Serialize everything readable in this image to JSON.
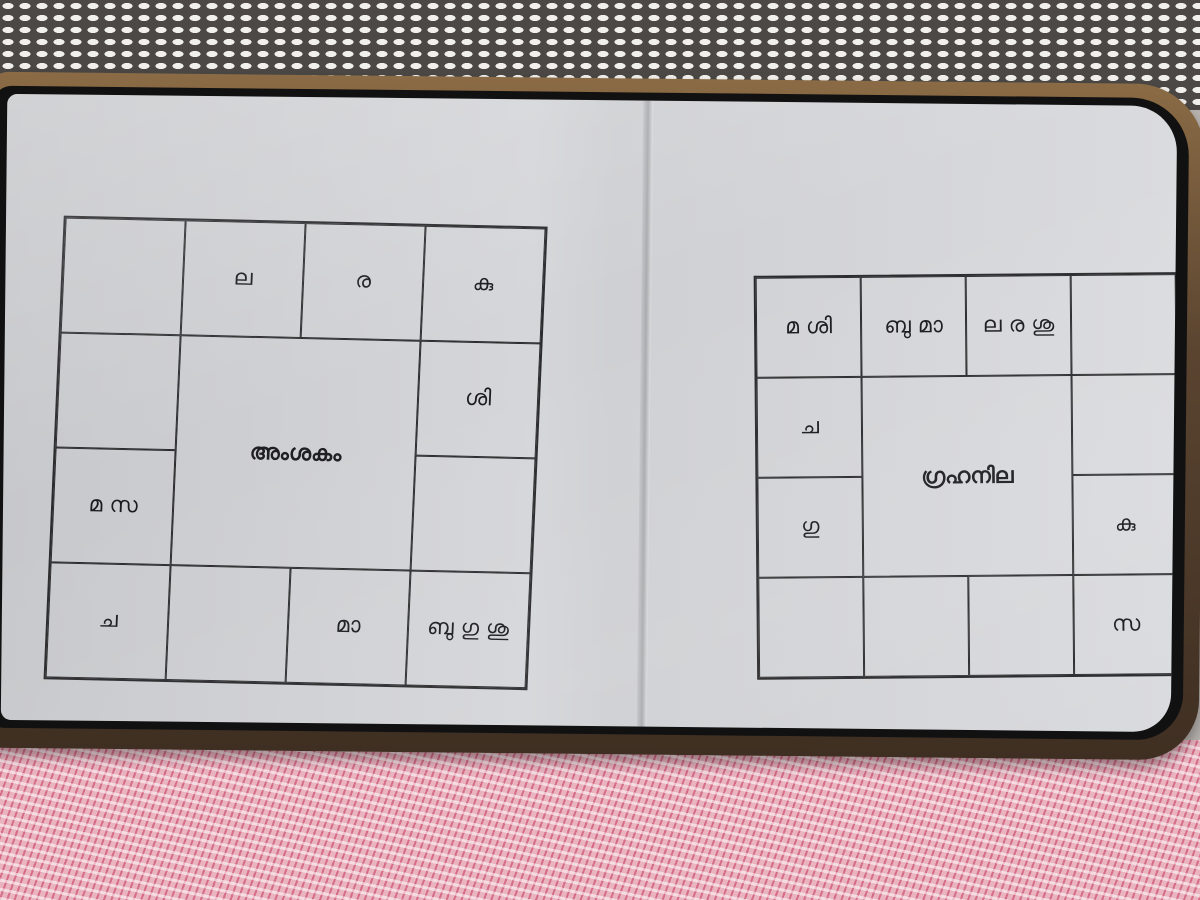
{
  "left_chart": {
    "title": "അംശകം",
    "cells": {
      "r0c0": "",
      "r0c1": "ല",
      "r0c2": "ര",
      "r0c3": "കു",
      "r1c0": "",
      "r1c3": "ശി",
      "r2c0": "മ സ",
      "r2c3": "",
      "r3c0": "ച",
      "r3c1": "",
      "r3c2": "മാ",
      "r3c3": "ബു ഗു ശു"
    }
  },
  "right_chart": {
    "title": "ഗ്രഹനില",
    "cells": {
      "r0c0": "മ ശി",
      "r0c1": "ബു മാ",
      "r0c2": "ല ര ശു",
      "r0c3": "",
      "r1c0": "ച",
      "r1c3": "",
      "r2c0": "ഗു",
      "r2c3": "കു",
      "r3c0": "",
      "r3c1": "",
      "r3c2": "",
      "r3c3": "സ"
    }
  }
}
